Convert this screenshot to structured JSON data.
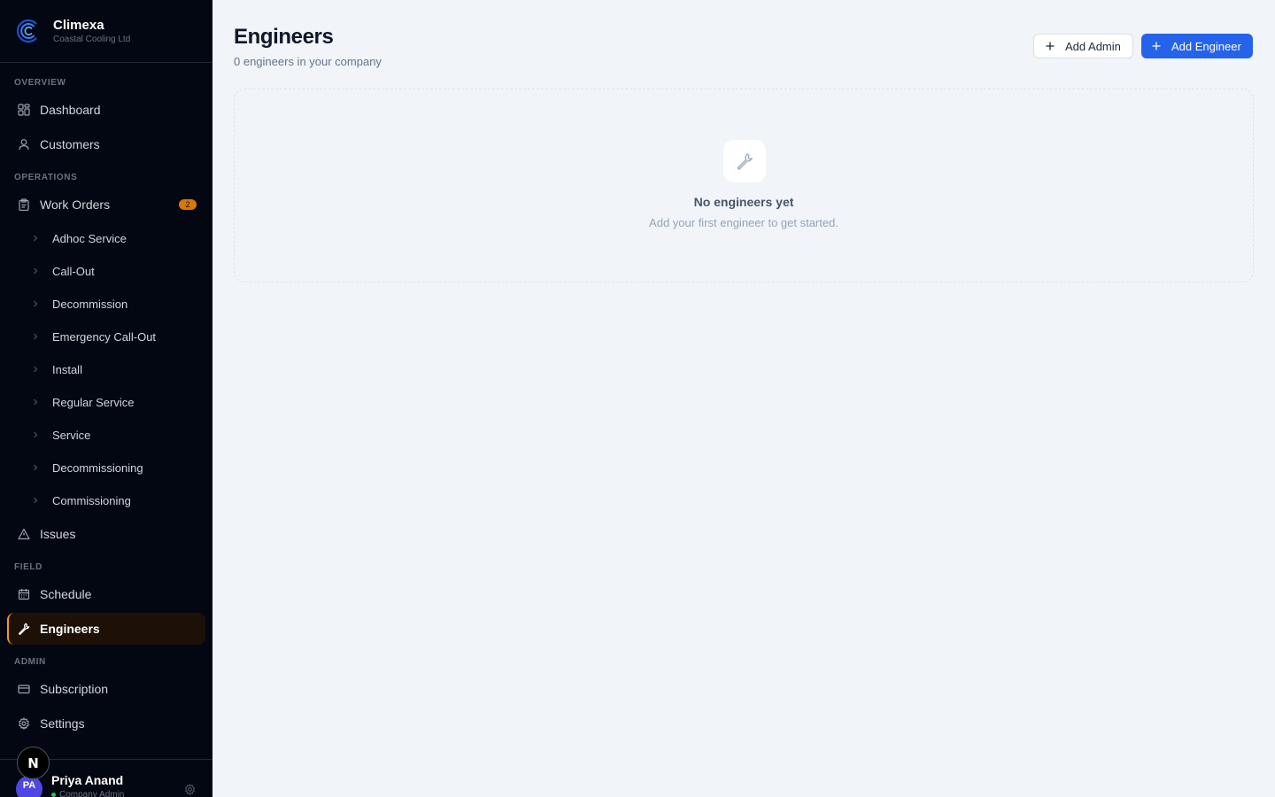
{
  "brand": {
    "name": "Climexa",
    "company": "Coastal Cooling Ltd"
  },
  "sidebar": {
    "sections": {
      "overview": "OVERVIEW",
      "operations": "OPERATIONS",
      "field": "FIELD",
      "admin": "ADMIN"
    },
    "items": {
      "dashboard": {
        "label": "Dashboard",
        "icon": "grid-icon"
      },
      "customers": {
        "label": "Customers",
        "icon": "user-icon"
      },
      "work_orders": {
        "label": "Work Orders",
        "icon": "clipboard-icon",
        "badge": "2"
      },
      "issues": {
        "label": "Issues",
        "icon": "warning-icon"
      },
      "schedule": {
        "label": "Schedule",
        "icon": "calendar-icon"
      },
      "engineers": {
        "label": "Engineers",
        "icon": "wrench-icon",
        "active": true
      },
      "subscription": {
        "label": "Subscription",
        "icon": "credit-card-icon"
      },
      "settings": {
        "label": "Settings",
        "icon": "gear-icon"
      }
    },
    "work_order_types": [
      "Adhoc Service",
      "Call-Out",
      "Decommission",
      "Emergency Call-Out",
      "Install",
      "Regular Service",
      "Service",
      "Decommissioning",
      "Commissioning"
    ]
  },
  "user": {
    "initials": "PA",
    "name": "Priya Anand",
    "role": "Company Admin"
  },
  "dev_badge": "N",
  "page": {
    "title": "Engineers",
    "subtitle": "0 engineers in your company",
    "add_admin_label": "Add Admin",
    "add_engineer_label": "Add Engineer"
  },
  "empty_state": {
    "title": "No engineers yet",
    "text": "Add your first engineer to get started.",
    "icon": "wrench-icon"
  },
  "colors": {
    "sidebar_bg": "#030712",
    "accent": "#f59e0b",
    "primary": "#2563eb",
    "page_bg": "#f1f5f9"
  }
}
